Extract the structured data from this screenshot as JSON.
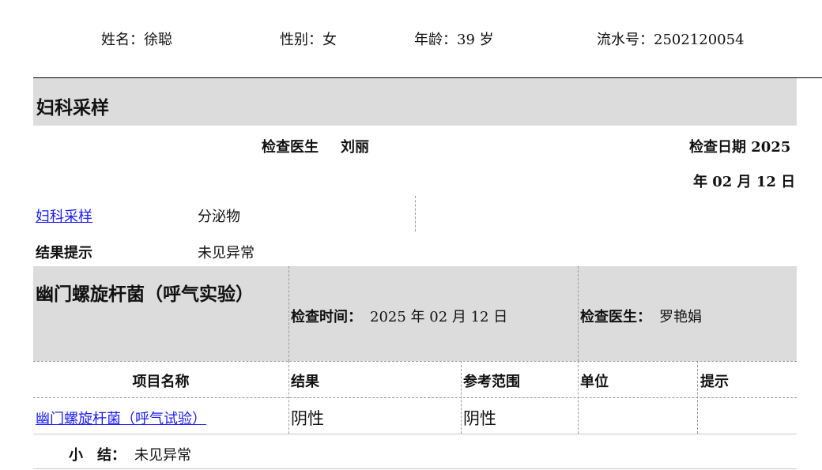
{
  "patient": {
    "name_label": "姓名：徐聪",
    "gender_label": "性别：女",
    "age_label": "年龄：39 岁",
    "serial_label": "流水号：2502120054"
  },
  "gyn": {
    "title": "妇科采样",
    "doctor_label": "检查医生",
    "doctor_name": "刘丽",
    "date_line1": "检查日期 2025",
    "date_line2": "年 02 月 12 日",
    "item_link": "妇科采样",
    "item_value": "分泌物",
    "result_label": "结果提示",
    "result_value": "未见异常"
  },
  "hp": {
    "title": "幽门螺旋杆菌（呼气实验）",
    "time_label": "检查时间：",
    "time_value": "2025 年 02 月 12 日",
    "doctor_label": "检查医生：",
    "doctor_name": "罗艳娟",
    "columns": [
      "项目名称",
      "结果",
      "参考范围",
      "单位",
      "提示"
    ],
    "rows": [
      {
        "name": "幽门螺旋杆菌（呼气试验）",
        "result": "阴性",
        "reference": "阴性",
        "unit": "",
        "hint": ""
      }
    ],
    "summary_label": "小　结：",
    "summary_value": "未见异常"
  }
}
